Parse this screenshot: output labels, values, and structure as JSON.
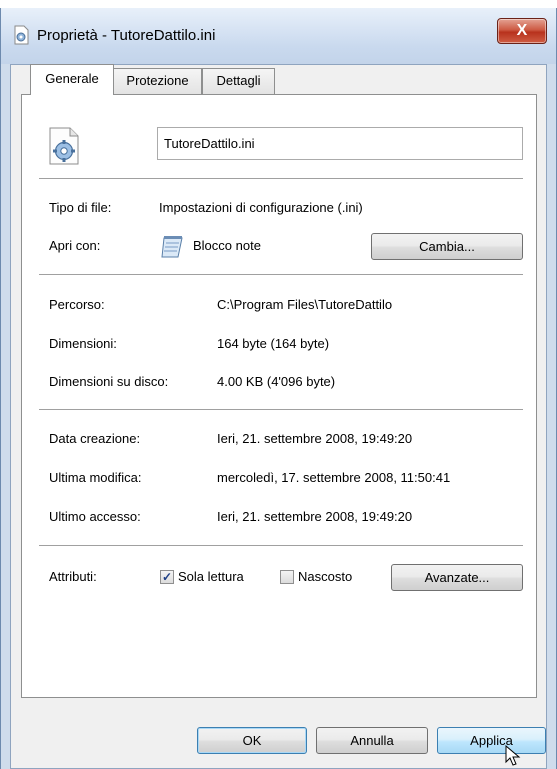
{
  "window": {
    "title": "Proprietà - TutoreDattilo.ini",
    "close_glyph": "X"
  },
  "tabs": [
    {
      "label": "Generale",
      "active": true
    },
    {
      "label": "Protezione",
      "active": false
    },
    {
      "label": "Dettagli",
      "active": false
    }
  ],
  "general": {
    "file_icon": "config-file-icon",
    "file_name": "TutoreDattilo.ini",
    "file_type_label": "Tipo di file:",
    "file_type_value": "Impostazioni di configurazione (.ini)",
    "open_with_label": "Apri con:",
    "open_with_icon": "notepad-icon",
    "open_with_value": "Blocco note",
    "change_button": "Cambia...",
    "path_label": "Percorso:",
    "path_value": "C:\\Program Files\\TutoreDattilo",
    "size_label": "Dimensioni:",
    "size_value": "164 byte (164 byte)",
    "disk_size_label": "Dimensioni su disco:",
    "disk_size_value": "4.00 KB (4'096 byte)",
    "created_label": "Data creazione:",
    "created_value": "Ieri, 21. settembre 2008, 19:49:20",
    "modified_label": "Ultima modifica:",
    "modified_value": "mercoledì, 17. settembre 2008, 11:50:41",
    "accessed_label": "Ultimo accesso:",
    "accessed_value": "Ieri, 21. settembre 2008, 19:49:20",
    "attributes_label": "Attributi:",
    "readonly_label": "Sola lettura",
    "readonly_checked": true,
    "hidden_label": "Nascosto",
    "hidden_checked": false,
    "advanced_button": "Avanzate..."
  },
  "footer": {
    "ok": "OK",
    "cancel": "Annulla",
    "apply": "Applica"
  },
  "colors": {
    "accent": "#3c7fb1",
    "close": "#c4402a",
    "frame": "#cfdcec"
  }
}
